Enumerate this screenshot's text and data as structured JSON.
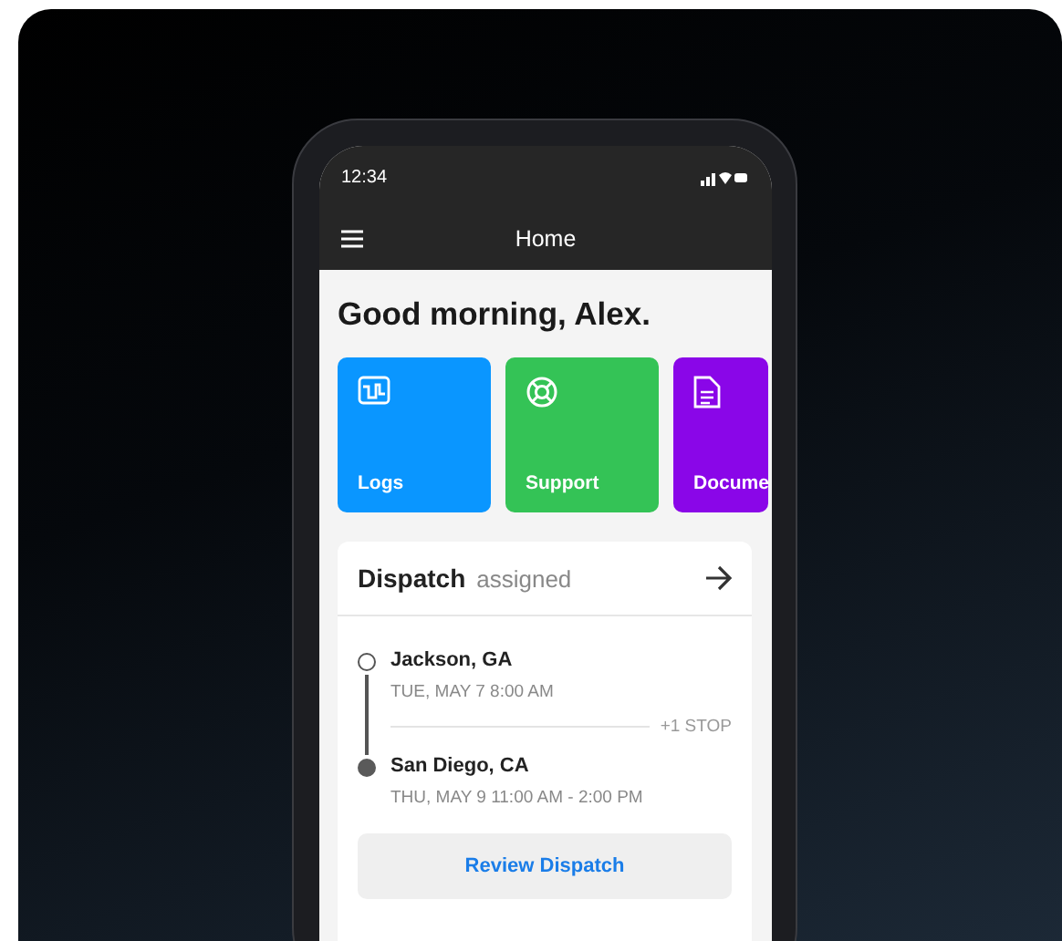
{
  "status_bar": {
    "time": "12:34"
  },
  "header": {
    "title": "Home"
  },
  "greeting": "Good morning, Alex.",
  "tiles": [
    {
      "label": "Logs",
      "kind": "logs",
      "color": "#0a96ff"
    },
    {
      "label": "Support",
      "kind": "support",
      "color": "#34c356"
    },
    {
      "label": "Docume",
      "kind": "document",
      "color": "#8a06e8"
    }
  ],
  "dispatch": {
    "title": "Dispatch",
    "status": "assigned",
    "stops": [
      {
        "kind": "origin",
        "place": "Jackson, GA",
        "time": "TUE, MAY 7  8:00 AM"
      },
      {
        "kind": "destination",
        "place": "San Diego, CA",
        "time": "THU, MAY 9  11:00 AM - 2:00 PM"
      }
    ],
    "extra_stops": "+1 STOP",
    "button": "Review Dispatch"
  }
}
